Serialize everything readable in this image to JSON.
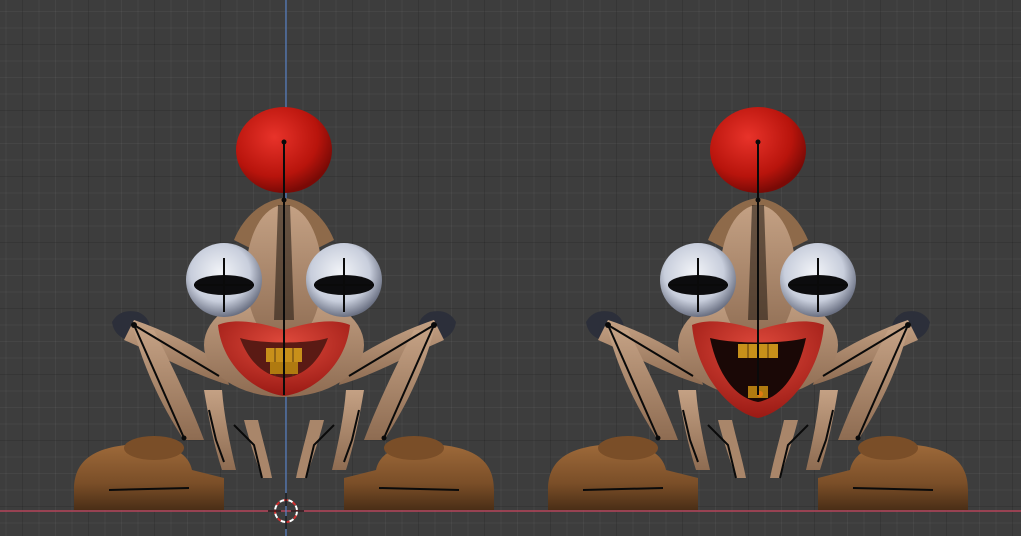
{
  "viewport": {
    "name": "3D Viewport",
    "background_color": "#3d3d3d",
    "grid_color": "#2e2e2e",
    "x_axis_color": "#b5445a",
    "z_axis_color": "#5a84c8"
  },
  "characters": [
    {
      "name": "clown-creature-left",
      "mouth_state": "closed-smile",
      "colors": {
        "nose": "#c81c12",
        "skin": "#b49074",
        "lips": "#c8322a",
        "teeth": "#c8901a",
        "eyes": "#dde2ec",
        "shoes": "#8a5a30",
        "bones": "#0a0a0a"
      }
    },
    {
      "name": "clown-creature-right",
      "mouth_state": "open-smile",
      "colors": {
        "nose": "#c81c12",
        "skin": "#b49074",
        "lips": "#c8322a",
        "teeth": "#c8901a",
        "eyes": "#dde2ec",
        "shoes": "#8a5a30",
        "bones": "#0a0a0a"
      }
    }
  ],
  "cursor": {
    "name": "3d-cursor",
    "colors": [
      "#ffffff",
      "#d03030"
    ]
  }
}
